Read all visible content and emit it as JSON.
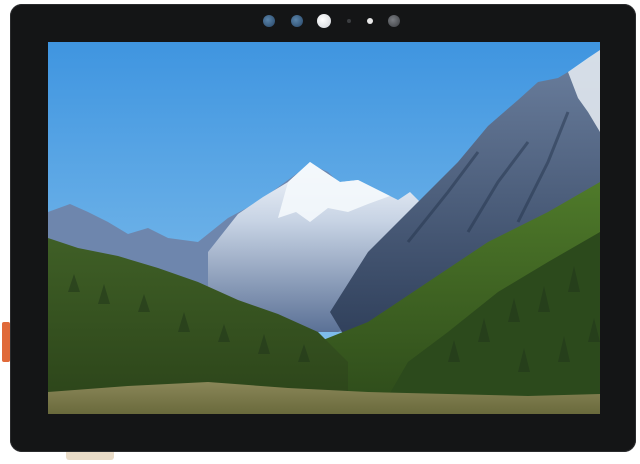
{
  "device": {
    "type": "tablet",
    "bezel_color": "#141516",
    "connector_color": "#e06a3a",
    "sensors": [
      "camera-lens-icon",
      "ir-sensor-icon",
      "front-camera-icon",
      "microphone-icon",
      "light-sensor-icon",
      "indicator-icon"
    ]
  },
  "screen": {
    "wallpaper": "mountain-landscape",
    "colors": {
      "sky_top": "#3f95e0",
      "sky_bottom": "#8fc7ee",
      "snow": "#f2f6fb",
      "rock": "#4d6385",
      "forest_dark": "#2f4a1f",
      "forest_light": "#5b7a2c",
      "meadow": "#7b7a4a"
    }
  }
}
